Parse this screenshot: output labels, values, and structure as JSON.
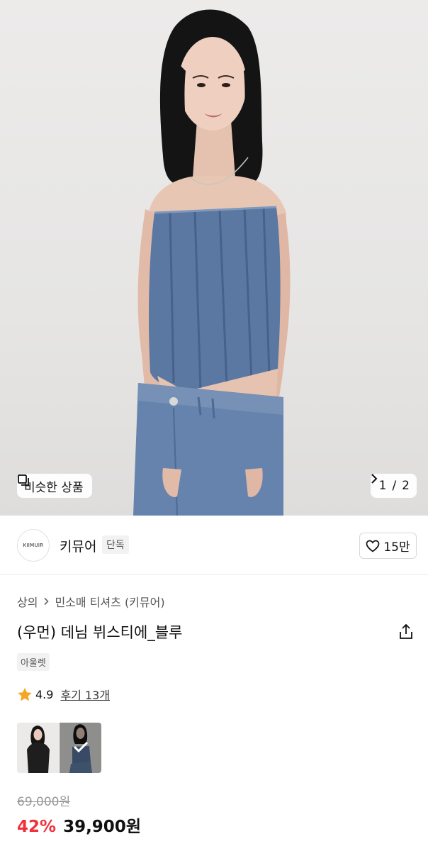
{
  "hero": {
    "similar_label": "비슷한 상품",
    "pager": {
      "current": "1",
      "separator": "/",
      "total": "2"
    }
  },
  "brand": {
    "logo_text": "KIIMUIR",
    "name": "키뮤어",
    "exclusive_badge": "단독",
    "likes": "15만"
  },
  "breadcrumb": {
    "items": [
      "상의",
      "민소매 티셔츠 (키뮤어)"
    ]
  },
  "product": {
    "title": "(우먼) 데님 뷔스티에_블루",
    "badge": "아울렛",
    "rating": "4.9",
    "reviews_label": "후기 13개"
  },
  "options": {
    "colors": [
      {
        "name": "black",
        "selected": false
      },
      {
        "name": "blue",
        "selected": true
      }
    ]
  },
  "price": {
    "original": "69,000원",
    "discount": "42%",
    "sale": "39,900원"
  },
  "colors": {
    "accent_red": "#f0313c",
    "star": "#f5a623",
    "denim": "#5b78a3"
  },
  "icons": [
    "similar-items-icon",
    "chevron-right-icon",
    "heart-icon",
    "share-icon",
    "star-icon",
    "check-icon"
  ]
}
